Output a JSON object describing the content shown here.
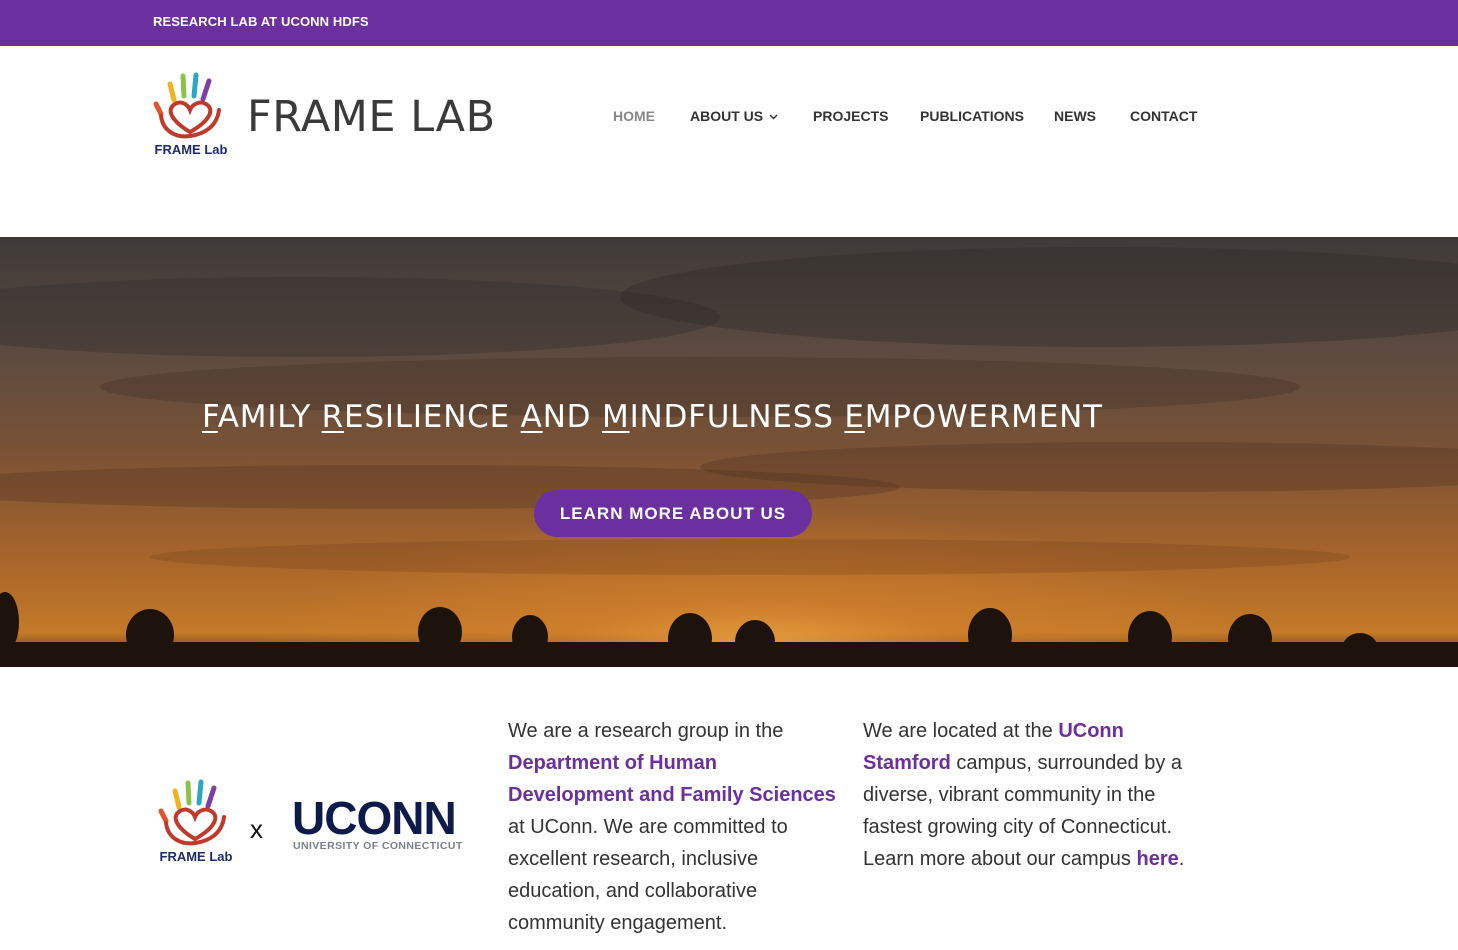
{
  "topbar": {
    "text": "RESEARCH LAB AT UCONN HDFS"
  },
  "header": {
    "logo_text": "FRAME Lab",
    "title": "FRAME LAB",
    "nav": [
      {
        "label": "HOME",
        "active": true
      },
      {
        "label": "ABOUT US",
        "has_dropdown": true
      },
      {
        "label": "PROJECTS"
      },
      {
        "label": "PUBLICATIONS"
      },
      {
        "label": "NEWS"
      },
      {
        "label": "CONTACT"
      }
    ]
  },
  "hero": {
    "heading_parts": [
      {
        "cap": "F",
        "rest": "AMILY "
      },
      {
        "cap": "R",
        "rest": "ESILIENCE "
      },
      {
        "cap": "A",
        "rest": "ND "
      },
      {
        "cap": "M",
        "rest": "INDFULNESS "
      },
      {
        "cap": "E",
        "rest": "MPOWERMENT"
      }
    ],
    "button_label": "LEARN MORE ABOUT US"
  },
  "partners": {
    "frame_logo_text": "FRAME Lab",
    "separator": "x",
    "uconn_word": "UCONN",
    "uconn_sub": "UNIVERSITY OF CONNECTICUT"
  },
  "about": {
    "p1_before": "We are a research group in the ",
    "p1_link": "Department of Human Development and Family Sciences",
    "p1_after": " at UConn. We are committed to excellent research, inclusive education, and collaborative community engagement.",
    "p2_before": "We are located at the ",
    "p2_link": "UConn Stamford",
    "p2_mid": " campus, surrounded by a diverse, vibrant community in the fastest growing city of Connecticut. Learn more about our campus ",
    "p2_link2": "here",
    "p2_after": "."
  },
  "colors": {
    "brand_purple": "#6b2fa0",
    "uconn_navy": "#0e1a4a"
  }
}
